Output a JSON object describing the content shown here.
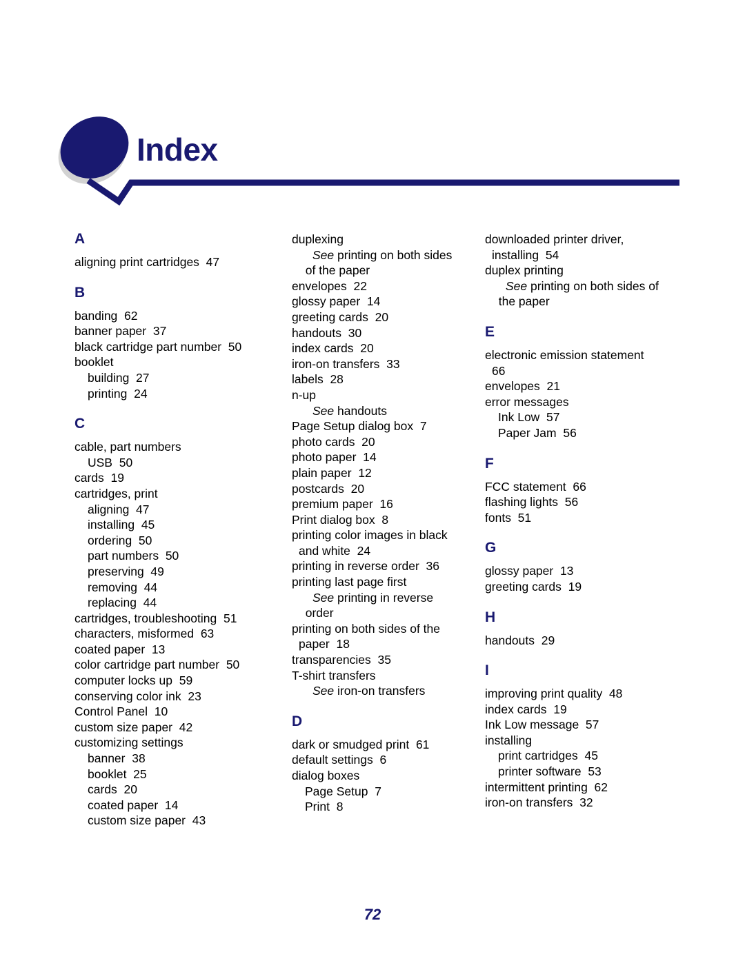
{
  "header": {
    "title": "Index",
    "accent_color": "#191970",
    "shadow_color": "#d0d0d0",
    "ellipse_icon": "ellipse-logo-icon",
    "rule_icon": "chevron-rule-icon"
  },
  "footer": {
    "page_number": "72"
  },
  "columns": [
    {
      "id": "column-1",
      "blocks": [
        {
          "letter": "A",
          "entries": [
            {
              "level": 1,
              "text": "aligning print cartridges  47"
            }
          ]
        },
        {
          "letter": "B",
          "entries": [
            {
              "level": 1,
              "text": "banding  62"
            },
            {
              "level": 1,
              "text": "banner paper  37"
            },
            {
              "level": 1,
              "text": "black cartridge part number  50"
            },
            {
              "level": 1,
              "text": "booklet"
            },
            {
              "level": 2,
              "text": "building  27"
            },
            {
              "level": 2,
              "text": "printing  24"
            }
          ]
        },
        {
          "letter": "C",
          "entries": [
            {
              "level": 1,
              "text": "cable, part numbers"
            },
            {
              "level": 2,
              "text": "USB  50"
            },
            {
              "level": 1,
              "text": "cards  19"
            },
            {
              "level": 1,
              "text": "cartridges, print"
            },
            {
              "level": 2,
              "text": "aligning  47"
            },
            {
              "level": 2,
              "text": "installing  45"
            },
            {
              "level": 2,
              "text": "ordering  50"
            },
            {
              "level": 2,
              "text": "part numbers  50"
            },
            {
              "level": 2,
              "text": "preserving  49"
            },
            {
              "level": 2,
              "text": "removing  44"
            },
            {
              "level": 2,
              "text": "replacing  44"
            },
            {
              "level": 1,
              "text": "cartridges, troubleshooting  51"
            },
            {
              "level": 1,
              "text": "characters, misformed  63"
            },
            {
              "level": 1,
              "text": "coated paper  13"
            },
            {
              "level": 1,
              "text": "color cartridge part number  50"
            },
            {
              "level": 1,
              "text": "computer locks up  59"
            },
            {
              "level": 1,
              "text": "conserving color ink  23"
            },
            {
              "level": 1,
              "text": "Control Panel  10"
            },
            {
              "level": 1,
              "text": "custom size paper  42"
            },
            {
              "level": 1,
              "text": "customizing settings"
            },
            {
              "level": 2,
              "text": "banner  38"
            },
            {
              "level": 2,
              "text": "booklet  25"
            },
            {
              "level": 2,
              "text": "cards  20"
            },
            {
              "level": 2,
              "text": "coated paper  14"
            },
            {
              "level": 2,
              "text": "custom size paper  43"
            }
          ]
        }
      ]
    },
    {
      "id": "column-2",
      "blocks": [
        {
          "letter": null,
          "entries": [
            {
              "level": 1,
              "text": "duplexing"
            },
            {
              "level": "see",
              "see": "See",
              "text": " printing on both sides"
            },
            {
              "level": "cont",
              "text": "  of the paper"
            },
            {
              "level": 1,
              "text": "envelopes  22"
            },
            {
              "level": 1,
              "text": "glossy paper  14"
            },
            {
              "level": 1,
              "text": "greeting cards  20"
            },
            {
              "level": 1,
              "text": "handouts  30"
            },
            {
              "level": 1,
              "text": "index cards  20"
            },
            {
              "level": 1,
              "text": "iron-on transfers  33"
            },
            {
              "level": 1,
              "text": "labels  28"
            },
            {
              "level": 1,
              "text": "n-up"
            },
            {
              "level": "see",
              "see": "See",
              "text": " handouts"
            },
            {
              "level": 1,
              "text": "Page Setup dialog box  7"
            },
            {
              "level": 1,
              "text": "photo cards  20"
            },
            {
              "level": 1,
              "text": "photo paper  14"
            },
            {
              "level": 1,
              "text": "plain paper  12"
            },
            {
              "level": 1,
              "text": "postcards  20"
            },
            {
              "level": 1,
              "text": "premium paper  16"
            },
            {
              "level": 1,
              "text": "Print dialog box  8"
            },
            {
              "level": 1,
              "text": "printing color images in black"
            },
            {
              "level": "cont",
              "text": "and white  24"
            },
            {
              "level": 1,
              "text": "printing in reverse order  36"
            },
            {
              "level": 1,
              "text": "printing last page first"
            },
            {
              "level": "see",
              "see": "See",
              "text": " printing in reverse"
            },
            {
              "level": "cont",
              "text": "  order"
            },
            {
              "level": 1,
              "text": "printing on both sides of the"
            },
            {
              "level": "cont",
              "text": "paper  18"
            },
            {
              "level": 1,
              "text": "transparencies  35"
            },
            {
              "level": 1,
              "text": "T-shirt transfers"
            },
            {
              "level": "see",
              "see": "See",
              "text": " iron-on transfers"
            }
          ]
        },
        {
          "letter": "D",
          "entries": [
            {
              "level": 1,
              "text": "dark or smudged print  61"
            },
            {
              "level": 1,
              "text": "default settings  6"
            },
            {
              "level": 1,
              "text": "dialog boxes"
            },
            {
              "level": 2,
              "text": "Page Setup  7"
            },
            {
              "level": 2,
              "text": "Print  8"
            }
          ]
        }
      ]
    },
    {
      "id": "column-3",
      "blocks": [
        {
          "letter": null,
          "entries": [
            {
              "level": 1,
              "text": "downloaded printer driver,"
            },
            {
              "level": "cont",
              "text": "installing  54"
            },
            {
              "level": 1,
              "text": "duplex printing"
            },
            {
              "level": "see",
              "see": "See",
              "text": " printing on both sides of"
            },
            {
              "level": "cont",
              "text": "  the paper"
            }
          ]
        },
        {
          "letter": "E",
          "entries": [
            {
              "level": 1,
              "text": "electronic emission statement"
            },
            {
              "level": "cont",
              "text": "66"
            },
            {
              "level": 1,
              "text": "envelopes  21"
            },
            {
              "level": 1,
              "text": "error messages"
            },
            {
              "level": 2,
              "text": "Ink Low  57"
            },
            {
              "level": 2,
              "text": "Paper Jam  56"
            }
          ]
        },
        {
          "letter": "F",
          "entries": [
            {
              "level": 1,
              "text": "FCC statement  66"
            },
            {
              "level": 1,
              "text": "flashing lights  56"
            },
            {
              "level": 1,
              "text": "fonts  51"
            }
          ]
        },
        {
          "letter": "G",
          "entries": [
            {
              "level": 1,
              "text": "glossy paper  13"
            },
            {
              "level": 1,
              "text": "greeting cards  19"
            }
          ]
        },
        {
          "letter": "H",
          "entries": [
            {
              "level": 1,
              "text": "handouts  29"
            }
          ]
        },
        {
          "letter": "I",
          "entries": [
            {
              "level": 1,
              "text": "improving print quality  48"
            },
            {
              "level": 1,
              "text": "index cards  19"
            },
            {
              "level": 1,
              "text": "Ink Low message  57"
            },
            {
              "level": 1,
              "text": "installing"
            },
            {
              "level": 2,
              "text": "print cartridges  45"
            },
            {
              "level": 2,
              "text": "printer software  53"
            },
            {
              "level": 1,
              "text": "intermittent printing  62"
            },
            {
              "level": 1,
              "text": "iron-on transfers  32"
            }
          ]
        }
      ]
    }
  ]
}
